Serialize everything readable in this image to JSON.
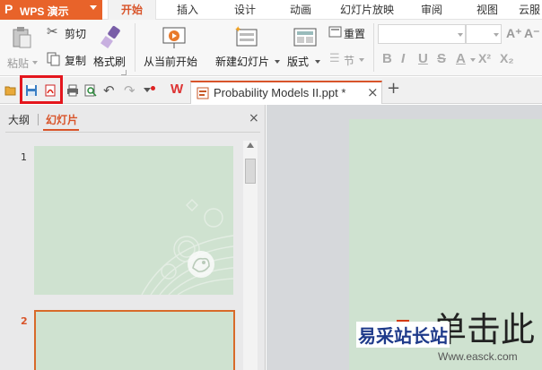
{
  "app": {
    "logo_letter": "P",
    "title": "WPS 演示"
  },
  "menu": {
    "tabs": [
      "开始",
      "插入",
      "设计",
      "动画",
      "幻灯片放映",
      "审阅",
      "视图",
      "云服"
    ]
  },
  "ribbon": {
    "paste": "粘贴",
    "cut": "剪切",
    "copy": "复制",
    "format_painter": "格式刷",
    "from_current": "从当前开始",
    "new_slide": "新建幻灯片",
    "layout": "版式",
    "reset": "重置",
    "section": "节",
    "font_buttons": [
      "B",
      "I",
      "U",
      "S",
      "A",
      "X²",
      "X₂"
    ],
    "grow_font": "A⁺",
    "shrink_font": "A⁻"
  },
  "document": {
    "tab_title": "Probability Models II.ppt *",
    "close_glyph": "×",
    "new_tab_glyph": "+"
  },
  "left_pane": {
    "outline_tab": "大纲",
    "slides_tab": "幻灯片",
    "close_glyph": "×",
    "slide_numbers": [
      "1",
      "2"
    ]
  },
  "main_slide": {
    "visible_text": "单击此"
  },
  "watermark": {
    "text": "易采站长站",
    "url": "Www.easck.com"
  },
  "colors": {
    "accent": "#d8542a",
    "app_button": "#e8632a",
    "slide_bg": "#cfe2d0",
    "highlight": "#e4161d",
    "bullet": "#d33a12"
  }
}
